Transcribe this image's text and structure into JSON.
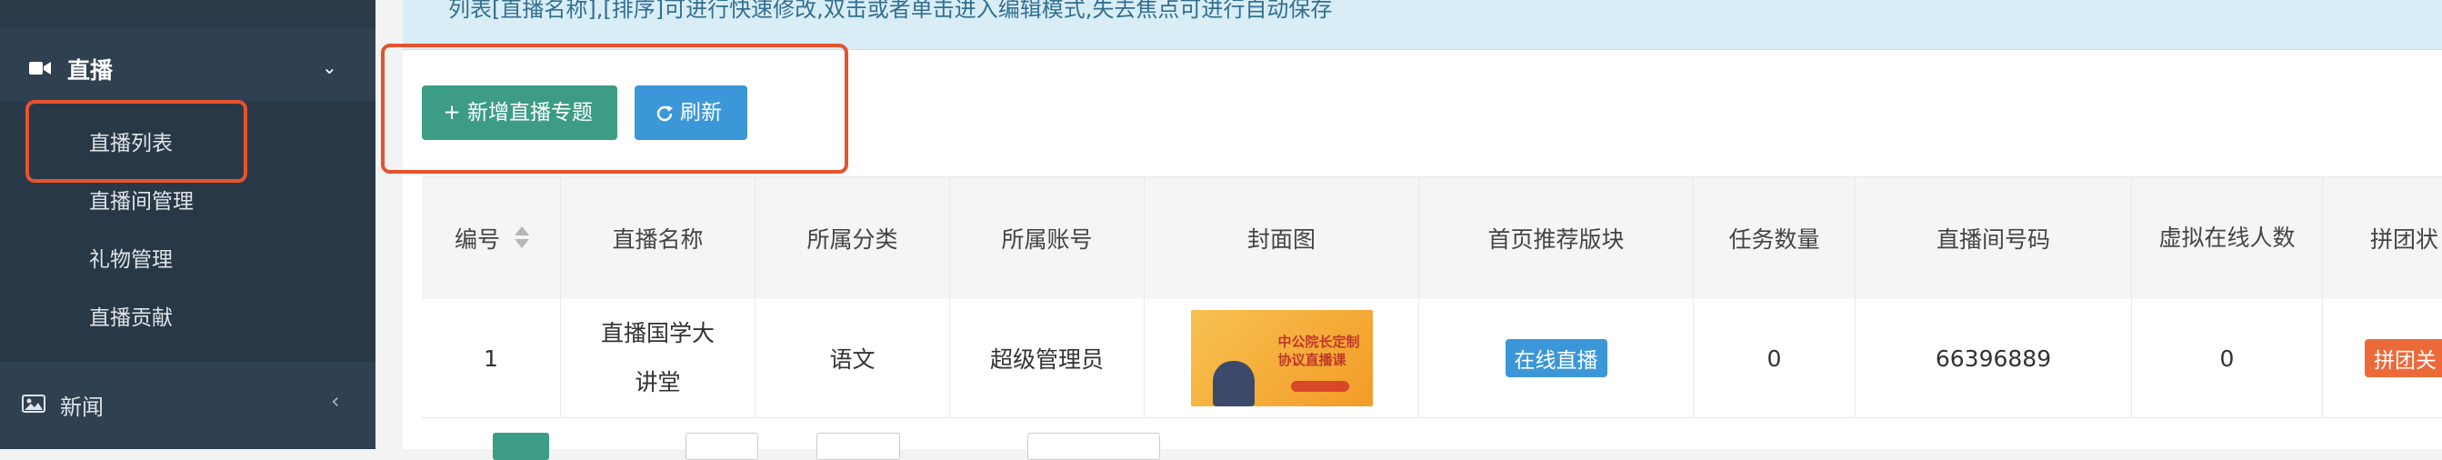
{
  "sidebar": {
    "live_menu": {
      "label": "直播",
      "icon": "video-camera-icon"
    },
    "live_items": [
      {
        "label": "直播列表"
      },
      {
        "label": "直播间管理"
      },
      {
        "label": "礼物管理"
      },
      {
        "label": "直播贡献"
      }
    ],
    "news_menu": {
      "label": "新闻",
      "icon": "image-icon"
    }
  },
  "notice": {
    "text": "列表[直播名称],[排序]可进行快速修改,双击或者单击进入编辑模式,失去焦点可进行自动保存"
  },
  "toolbar": {
    "add_label": "新增直播专题",
    "refresh_label": "刷新"
  },
  "table": {
    "headers": [
      "编号",
      "直播名称",
      "所属分类",
      "所属账号",
      "封面图",
      "首页推荐版块",
      "任务数量",
      "直播间号码",
      "虚拟在线人数",
      "拼团状"
    ],
    "rows": [
      {
        "id": "1",
        "name": "直播国学大讲堂",
        "category": "语文",
        "account": "超级管理员",
        "cover_text_1": "中公院长定制",
        "cover_text_2": "协议直播课",
        "recommend": "在线直播",
        "task_count": "0",
        "room_number": "66396889",
        "virtual_online": "0",
        "group_status": "拼团关"
      }
    ]
  },
  "colors": {
    "sidebar_bg": "#2f4050",
    "highlight_border": "#e5532d",
    "add_button": "#3d9c85",
    "refresh_button": "#3c97d8",
    "badge_blue": "#3c97d8",
    "badge_orange": "#ec6a3a"
  }
}
